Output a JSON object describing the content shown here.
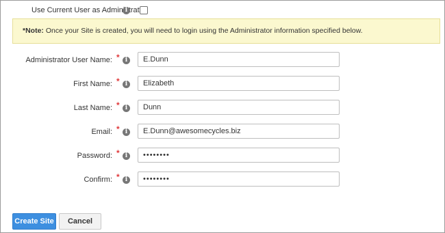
{
  "admin_toggle": {
    "label": "Use Current User as Administrator:",
    "checked": false
  },
  "note": {
    "prefix": "*Note:",
    "text": "Once your Site is created, you will need to login using the Administrator information specified below."
  },
  "form": {
    "required_marker": "*",
    "fields": {
      "admin_user_name": {
        "label": "Administrator User Name:",
        "value": "E.Dunn"
      },
      "first_name": {
        "label": "First Name:",
        "value": "Elizabeth"
      },
      "last_name": {
        "label": "Last Name:",
        "value": "Dunn"
      },
      "email": {
        "label": "Email:",
        "value": "E.Dunn@awesomecycles.biz"
      },
      "password": {
        "label": "Password:",
        "value": "••••••••"
      },
      "confirm": {
        "label": "Confirm:",
        "value": "••••••••"
      }
    }
  },
  "actions": {
    "create_site": "Create Site",
    "cancel": "Cancel"
  },
  "colors": {
    "primary_button": "#3d8fe0",
    "required_marker": "#e0393b",
    "note_background": "#fbf8cf"
  },
  "icons": {
    "info": "info-icon",
    "checkbox": "checkbox"
  }
}
